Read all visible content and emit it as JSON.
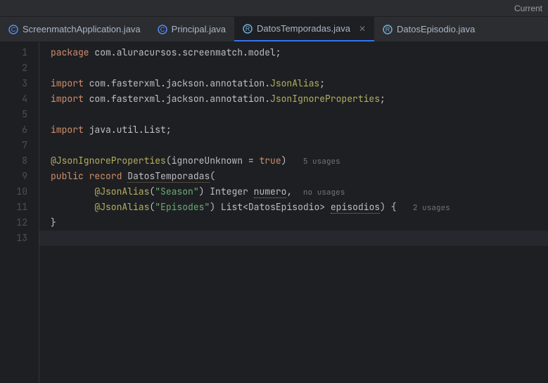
{
  "topbar": {
    "right_text": "Current"
  },
  "tabs": [
    {
      "label": "ScreenmatchApplication.java",
      "icon_color": "#548af7",
      "active": false
    },
    {
      "label": "Principal.java",
      "icon_color": "#548af7",
      "active": false
    },
    {
      "label": "DatosTemporadas.java",
      "icon_color": "#6fb0d9",
      "active": true
    },
    {
      "label": "DatosEpisodio.java",
      "icon_color": "#6fb0d9",
      "active": false
    }
  ],
  "editor": {
    "line_numbers": [
      "1",
      "2",
      "3",
      "4",
      "5",
      "6",
      "7",
      "8",
      "9",
      "10",
      "11",
      "12",
      "13"
    ],
    "lines": {
      "l1": {
        "kw": "package",
        "rest": " com.aluracursos.screenmatch.model;"
      },
      "l3": {
        "kw": "import",
        "rest1": " com.fasterxml.jackson.annotation.",
        "cls": "JsonAlias",
        "rest2": ";"
      },
      "l4": {
        "kw": "import",
        "rest1": " com.fasterxml.jackson.annotation.",
        "cls": "JsonIgnoreProperties",
        "rest2": ";"
      },
      "l6": {
        "kw": "import",
        "rest": " java.util.List;"
      },
      "l8": {
        "ann": "@JsonIgnoreProperties",
        "open": "(",
        "param": "ignoreUnknown = ",
        "val": "true",
        "close": ")",
        "usage": "5 usages"
      },
      "l9": {
        "kw1": "public",
        "kw2": "record",
        "name": "DatosTemporadas",
        "open": "("
      },
      "l10": {
        "ann": "@JsonAlias",
        "open": "(",
        "str": "\"Season\"",
        "close": ")",
        "type": " Integer ",
        "var": "numero",
        "comma": ",",
        "usage": "no usages"
      },
      "l11": {
        "ann": "@JsonAlias",
        "open": "(",
        "str": "\"Episodes\"",
        "close": ")",
        "type": " List<DatosEpisodio> ",
        "var": "episodios",
        "close2": ") {",
        "usage": "2 usages"
      },
      "l12": {
        "brace": "}"
      }
    }
  }
}
